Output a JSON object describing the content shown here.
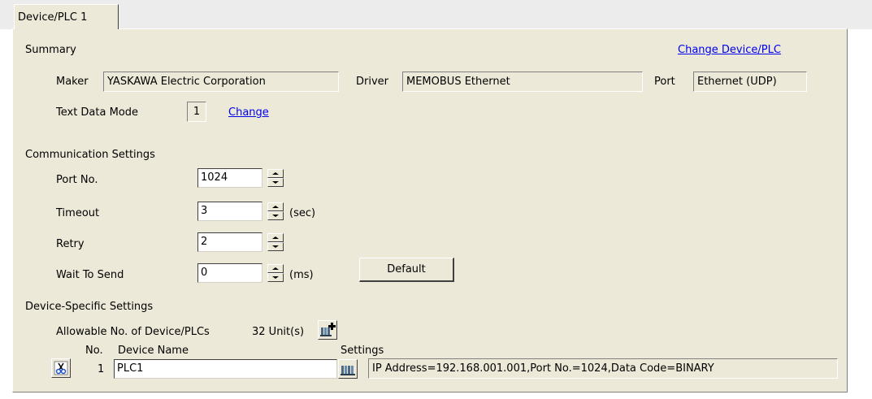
{
  "tab": {
    "label": "Device/PLC 1"
  },
  "summary": {
    "heading": "Summary",
    "change_device_link": "Change Device/PLC",
    "maker_label": "Maker",
    "maker_value": "YASKAWA Electric Corporation",
    "driver_label": "Driver",
    "driver_value": "MEMOBUS Ethernet",
    "port_label": "Port",
    "port_value": "Ethernet (UDP)",
    "text_mode_label": "Text Data Mode",
    "text_mode_value": "1",
    "change_link": "Change"
  },
  "comm": {
    "heading": "Communication Settings",
    "port_no_label": "Port No.",
    "port_no_value": "1024",
    "timeout_label": "Timeout",
    "timeout_value": "3",
    "timeout_unit": "(sec)",
    "retry_label": "Retry",
    "retry_value": "2",
    "wait_label": "Wait To Send",
    "wait_value": "0",
    "wait_unit": "(ms)",
    "default_button": "Default"
  },
  "device": {
    "heading": "Device-Specific Settings",
    "allowable_label": "Allowable No. of Device/PLCs",
    "allowable_value": "32 Unit(s)",
    "col_no": "No.",
    "col_device_name": "Device Name",
    "col_settings": "Settings",
    "rows": [
      {
        "no": "1",
        "name": "PLC1",
        "settings": "IP Address=192.168.001.001,Port No.=1024,Data Code=BINARY"
      }
    ]
  },
  "colors": {
    "panel": "#ece9d8",
    "link": "#0000ee"
  },
  "icons": [
    "cut-icon",
    "add-device-icon",
    "device-settings-icon",
    "spin-up-icon",
    "spin-down-icon"
  ]
}
